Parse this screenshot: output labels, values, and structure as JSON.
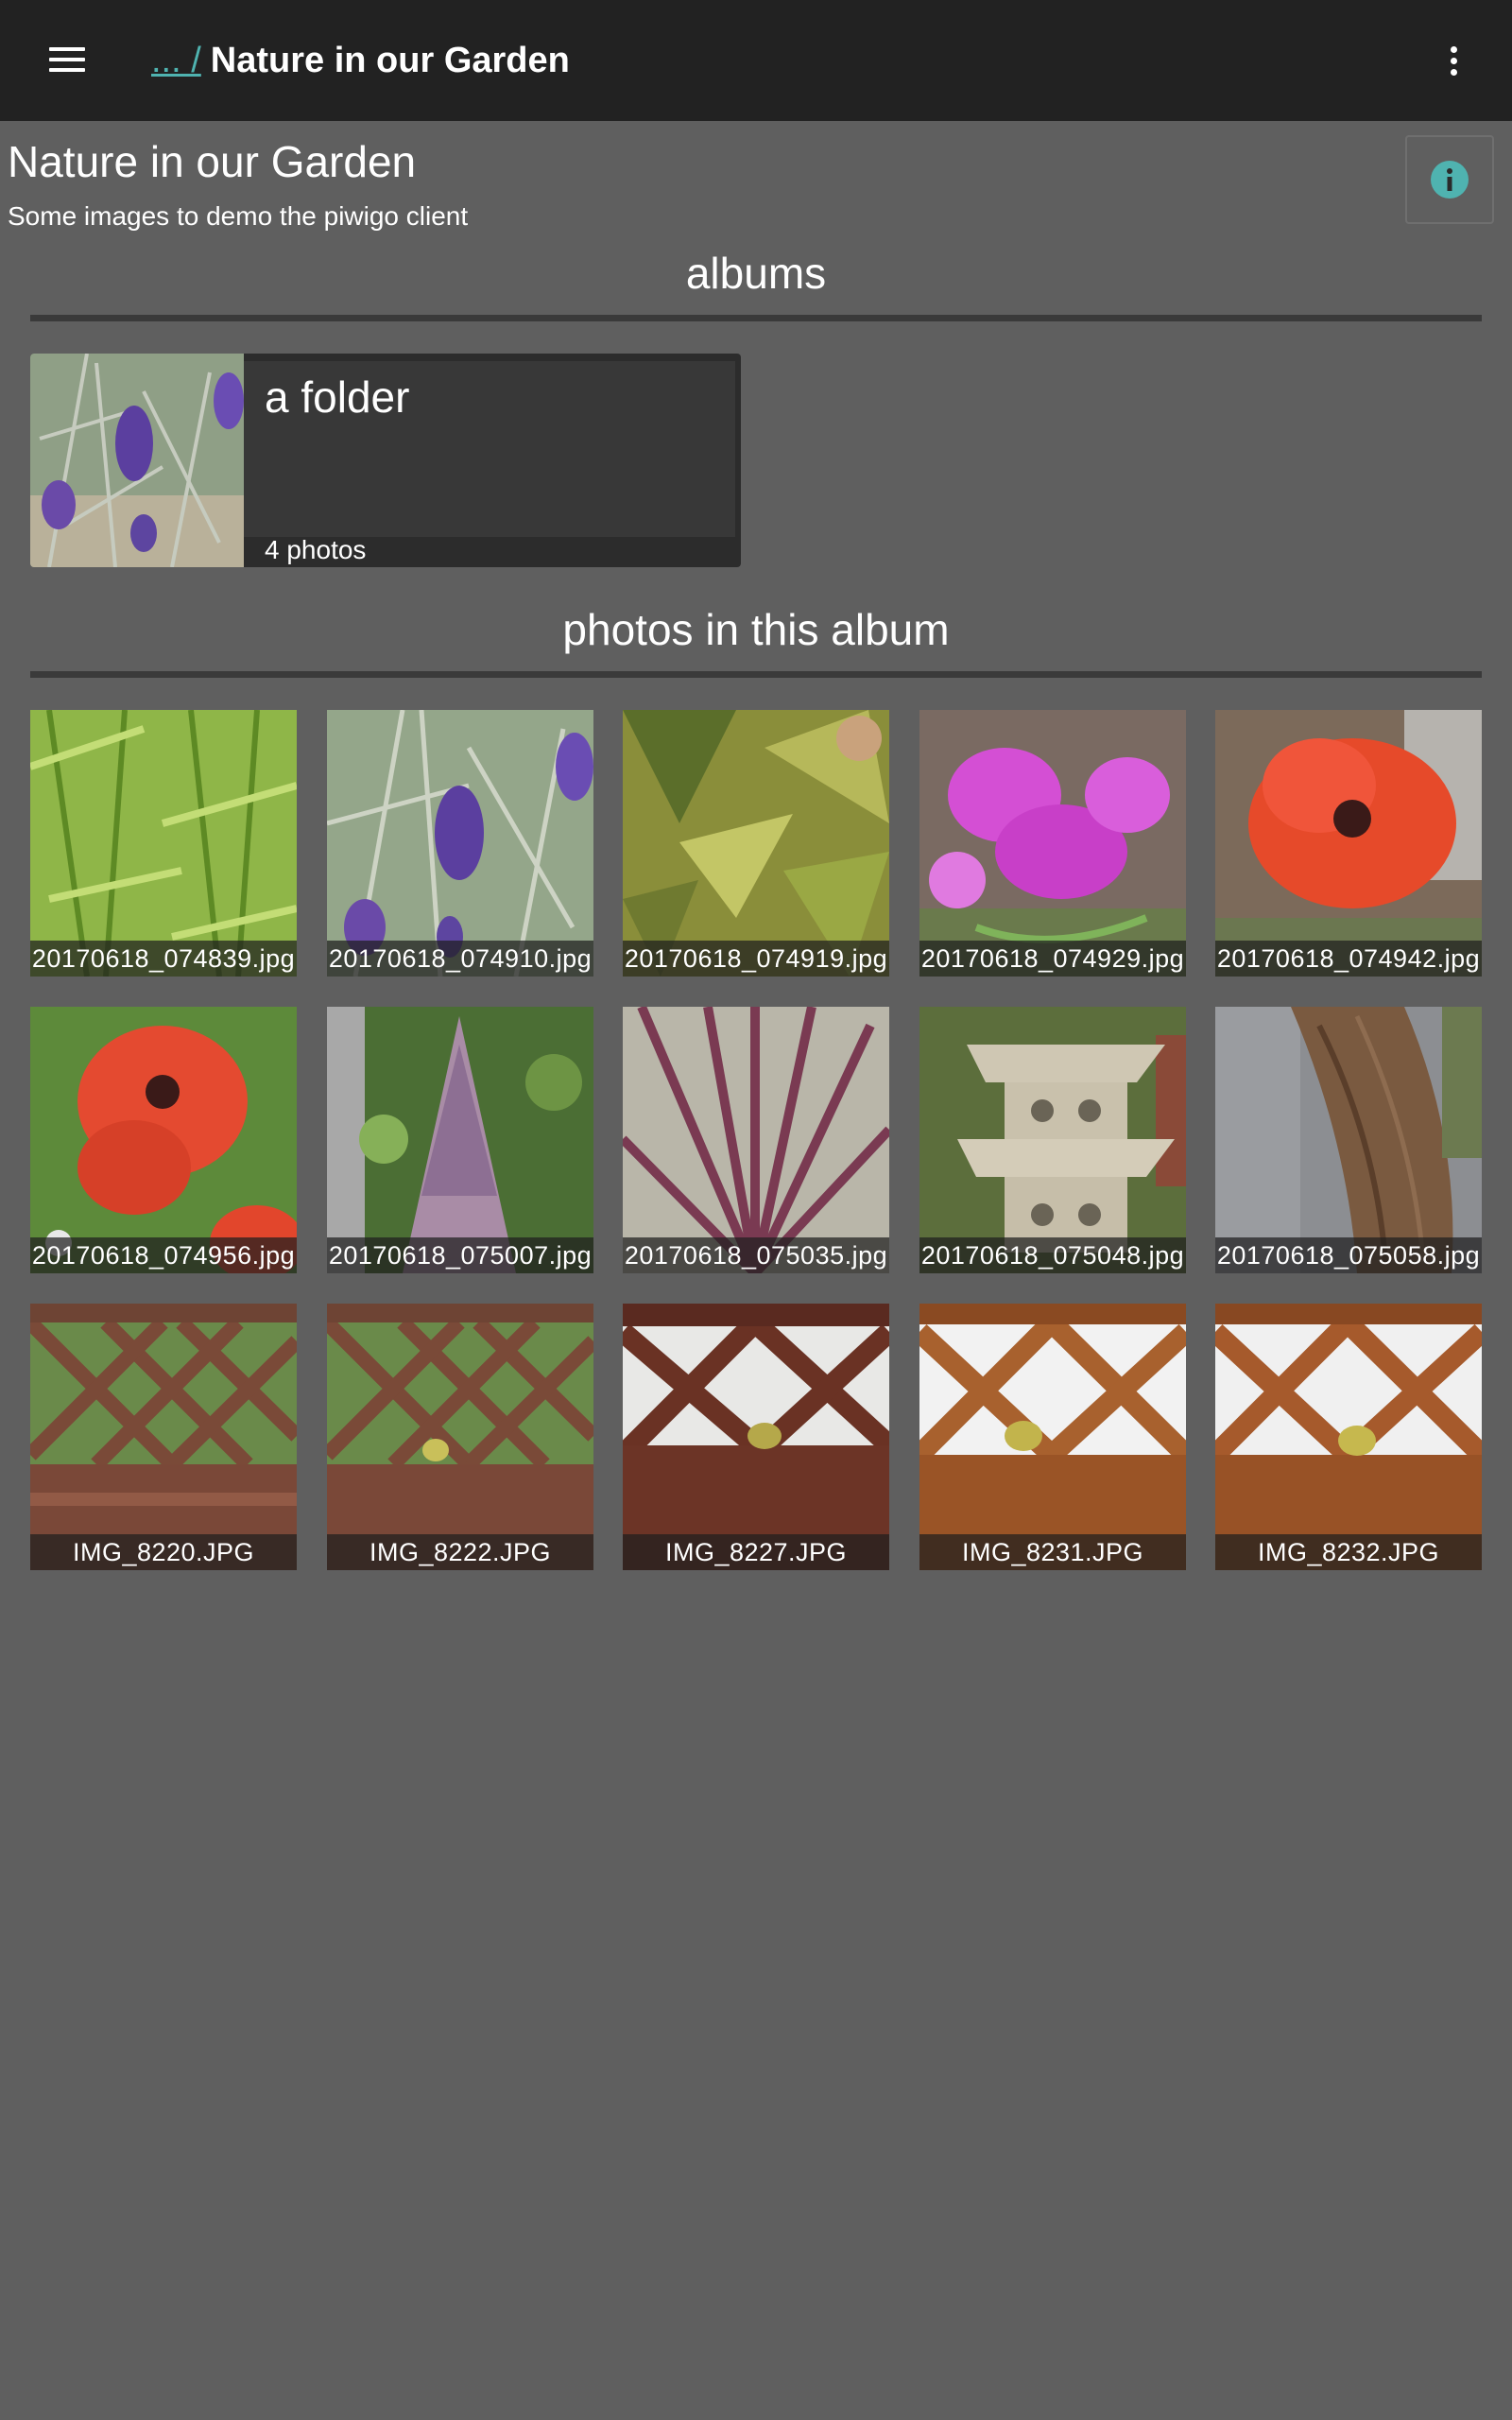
{
  "appbar": {
    "breadcrumb_link": "... /",
    "title": "Nature in our Garden",
    "menu_icon": "hamburger-menu-icon",
    "overflow_icon": "more-vert-icon"
  },
  "header": {
    "title": "Nature in our Garden",
    "description": "Some images to demo the piwigo client",
    "info_icon": "info-icon"
  },
  "albums_section": {
    "heading": "albums"
  },
  "albums": [
    {
      "name": "a folder",
      "count": "4 photos"
    }
  ],
  "photos_section": {
    "heading": "photos in this album"
  },
  "photos": [
    {
      "caption": "20170618_074839.jpg"
    },
    {
      "caption": "20170618_074910.jpg"
    },
    {
      "caption": "20170618_074919.jpg"
    },
    {
      "caption": "20170618_074929.jpg"
    },
    {
      "caption": "20170618_074942.jpg"
    },
    {
      "caption": "20170618_074956.jpg"
    },
    {
      "caption": "20170618_075007.jpg"
    },
    {
      "caption": "20170618_075035.jpg"
    },
    {
      "caption": "20170618_075048.jpg"
    },
    {
      "caption": "20170618_075058.jpg"
    },
    {
      "caption": "IMG_8220.JPG"
    },
    {
      "caption": "IMG_8222.JPG"
    },
    {
      "caption": "IMG_8227.JPG"
    },
    {
      "caption": "IMG_8231.JPG"
    },
    {
      "caption": "IMG_8232.JPG"
    }
  ],
  "colors": {
    "appbar": "#222222",
    "background": "#5f5f5f",
    "accent": "#4fb3b0",
    "card": "#383838"
  }
}
